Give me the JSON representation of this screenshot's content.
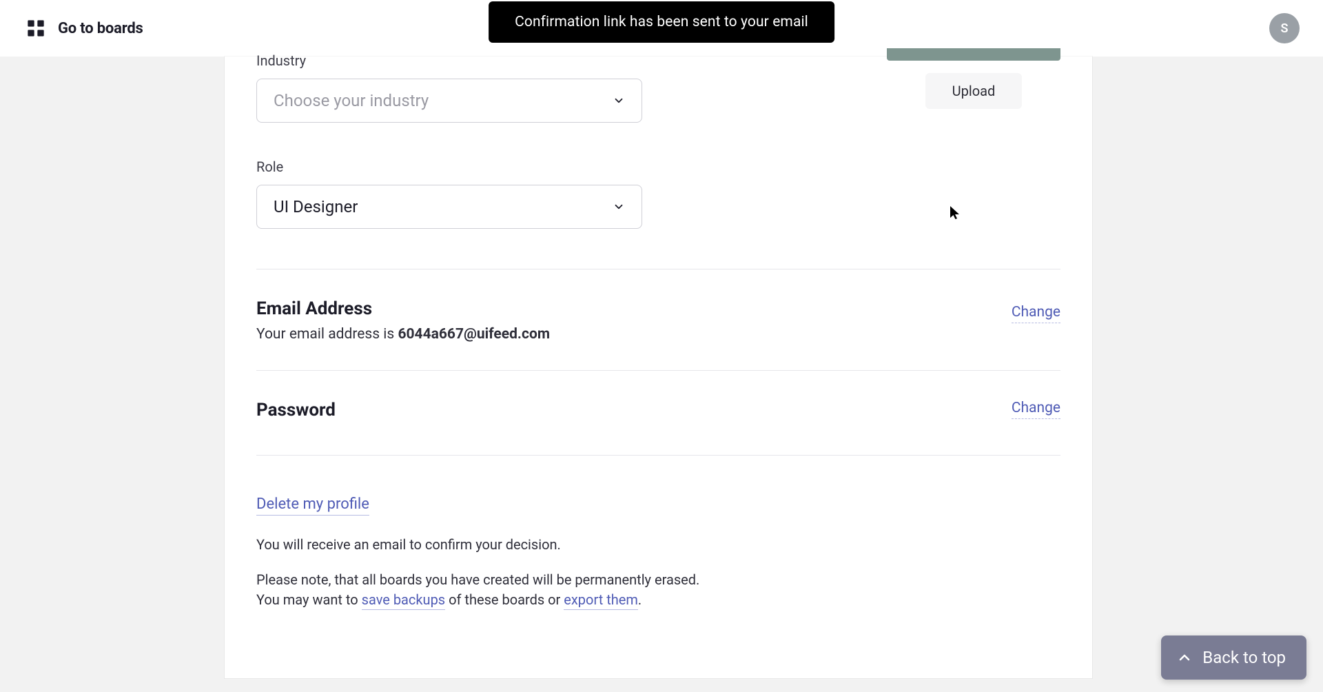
{
  "header": {
    "boards_label": "Go to boards",
    "avatar_initial": "S"
  },
  "toast": {
    "message": "Confirmation link has been sent to your email"
  },
  "form": {
    "industry_label": "Industry",
    "industry_placeholder": "Choose your industry",
    "role_label": "Role",
    "role_value": "UI Designer"
  },
  "upload": {
    "button_label": "Upload"
  },
  "email": {
    "heading": "Email Address",
    "prefix": "Your email address is ",
    "address": "6044a667@uifeed.com",
    "change_label": "Change"
  },
  "password": {
    "heading": "Password",
    "change_label": "Change"
  },
  "delete": {
    "link_label": "Delete my profile",
    "confirm_text": "You will receive an email to confirm your decision.",
    "warn_1": "Please note, that all boards you have created will be permanently erased.",
    "warn_2_a": "You may want to ",
    "warn_2_link1": "save backups",
    "warn_2_b": " of these boards or ",
    "warn_2_link2": "export them",
    "warn_2_c": "."
  },
  "back_to_top": {
    "label": "Back to top"
  }
}
